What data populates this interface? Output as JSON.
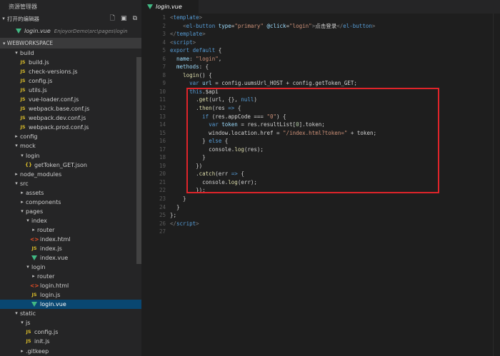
{
  "sidebar": {
    "title": "资源管理器",
    "open_editors_label": "打开的编辑器",
    "open_editor_file": {
      "name": "login.vue",
      "path": "EnjoyorDemo\\src\\pages\\login"
    },
    "workspace_label": "WEBWORKSPACE",
    "tree": [
      {
        "indent": 1,
        "twistie": "open",
        "icon": "",
        "label": "build"
      },
      {
        "indent": 2,
        "twistie": "none",
        "icon": "js",
        "label": "build.js"
      },
      {
        "indent": 2,
        "twistie": "none",
        "icon": "js",
        "label": "check-versions.js"
      },
      {
        "indent": 2,
        "twistie": "none",
        "icon": "js",
        "label": "config.js"
      },
      {
        "indent": 2,
        "twistie": "none",
        "icon": "js",
        "label": "utils.js"
      },
      {
        "indent": 2,
        "twistie": "none",
        "icon": "js",
        "label": "vue-loader.conf.js"
      },
      {
        "indent": 2,
        "twistie": "none",
        "icon": "js",
        "label": "webpack.base.conf.js"
      },
      {
        "indent": 2,
        "twistie": "none",
        "icon": "js",
        "label": "webpack.dev.conf.js"
      },
      {
        "indent": 2,
        "twistie": "none",
        "icon": "js",
        "label": "webpack.prod.conf.js"
      },
      {
        "indent": 1,
        "twistie": "closed",
        "icon": "",
        "label": "config"
      },
      {
        "indent": 1,
        "twistie": "open",
        "icon": "",
        "label": "mock"
      },
      {
        "indent": 2,
        "twistie": "open",
        "icon": "",
        "label": "login"
      },
      {
        "indent": 3,
        "twistie": "none",
        "icon": "json",
        "label": "getToken_GET.json"
      },
      {
        "indent": 1,
        "twistie": "closed",
        "icon": "",
        "label": "node_modules"
      },
      {
        "indent": 1,
        "twistie": "open",
        "icon": "",
        "label": "src"
      },
      {
        "indent": 2,
        "twistie": "closed",
        "icon": "",
        "label": "assets"
      },
      {
        "indent": 2,
        "twistie": "closed",
        "icon": "",
        "label": "components"
      },
      {
        "indent": 2,
        "twistie": "open",
        "icon": "",
        "label": "pages"
      },
      {
        "indent": 3,
        "twistie": "open",
        "icon": "",
        "label": "index"
      },
      {
        "indent": 4,
        "twistie": "closed",
        "icon": "",
        "label": "router"
      },
      {
        "indent": 4,
        "twistie": "none",
        "icon": "html",
        "label": "index.html"
      },
      {
        "indent": 4,
        "twistie": "none",
        "icon": "js",
        "label": "index.js"
      },
      {
        "indent": 4,
        "twistie": "none",
        "icon": "vue",
        "label": "index.vue"
      },
      {
        "indent": 3,
        "twistie": "open",
        "icon": "",
        "label": "login"
      },
      {
        "indent": 4,
        "twistie": "closed",
        "icon": "",
        "label": "router"
      },
      {
        "indent": 4,
        "twistie": "none",
        "icon": "html",
        "label": "login.html"
      },
      {
        "indent": 4,
        "twistie": "none",
        "icon": "js",
        "label": "login.js"
      },
      {
        "indent": 4,
        "twistie": "none",
        "icon": "vue",
        "label": "login.vue",
        "selected": true
      },
      {
        "indent": 1,
        "twistie": "open",
        "icon": "",
        "label": "static"
      },
      {
        "indent": 2,
        "twistie": "open",
        "icon": "",
        "label": "js"
      },
      {
        "indent": 3,
        "twistie": "none",
        "icon": "js",
        "label": "config.js"
      },
      {
        "indent": 3,
        "twistie": "none",
        "icon": "js",
        "label": "init.js"
      },
      {
        "indent": 2,
        "twistie": "closed",
        "icon": "",
        "label": ".gitkeep"
      }
    ]
  },
  "editor": {
    "tab_label": "login.vue",
    "lines": [
      [
        [
          "ang",
          "<"
        ],
        [
          "tag",
          "template"
        ],
        [
          "ang",
          ">"
        ]
      ],
      [
        [
          "plain",
          "    "
        ],
        [
          "ang",
          "<"
        ],
        [
          "tag",
          "el-button"
        ],
        [
          "plain",
          " "
        ],
        [
          "attr",
          "type"
        ],
        [
          "plain",
          "="
        ],
        [
          "str",
          "\"primary\""
        ],
        [
          "plain",
          " "
        ],
        [
          "attr",
          "@click"
        ],
        [
          "plain",
          "="
        ],
        [
          "str",
          "\"login\""
        ],
        [
          "ang",
          ">"
        ],
        [
          "plain",
          "点击登录"
        ],
        [
          "ang",
          "</"
        ],
        [
          "tag",
          "el-button"
        ],
        [
          "ang",
          ">"
        ]
      ],
      [
        [
          "ang",
          "</"
        ],
        [
          "tag",
          "template"
        ],
        [
          "ang",
          ">"
        ]
      ],
      [
        [
          "ang",
          "<"
        ],
        [
          "tag",
          "script"
        ],
        [
          "ang",
          ">"
        ]
      ],
      [
        [
          "kw",
          "export"
        ],
        [
          "plain",
          " "
        ],
        [
          "kw",
          "default"
        ],
        [
          "plain",
          " {"
        ]
      ],
      [
        [
          "plain",
          "  "
        ],
        [
          "prop",
          "name"
        ],
        [
          "plain",
          ": "
        ],
        [
          "str",
          "\"login\""
        ],
        [
          "plain",
          ","
        ]
      ],
      [
        [
          "plain",
          "  "
        ],
        [
          "prop",
          "methods"
        ],
        [
          "plain",
          ": {"
        ]
      ],
      [
        [
          "plain",
          "    "
        ],
        [
          "fn",
          "login"
        ],
        [
          "plain",
          "() {"
        ]
      ],
      [
        [
          "plain",
          "      "
        ],
        [
          "kw",
          "var"
        ],
        [
          "plain",
          " "
        ],
        [
          "prop",
          "url"
        ],
        [
          "plain",
          " = config.uumsUrl_HOST + config.getToken_GET;"
        ]
      ],
      [
        [
          "plain",
          "      "
        ],
        [
          "this",
          "this"
        ],
        [
          "plain",
          ".$api"
        ]
      ],
      [
        [
          "plain",
          "        ."
        ],
        [
          "fn",
          "get"
        ],
        [
          "plain",
          "(url, {}, "
        ],
        [
          "kw",
          "null"
        ],
        [
          "plain",
          ")"
        ]
      ],
      [
        [
          "plain",
          "        ."
        ],
        [
          "fn",
          "then"
        ],
        [
          "plain",
          "(res "
        ],
        [
          "kw",
          "=>"
        ],
        [
          "plain",
          " {"
        ]
      ],
      [
        [
          "plain",
          "          "
        ],
        [
          "kw",
          "if"
        ],
        [
          "plain",
          " (res.appCode === "
        ],
        [
          "str",
          "\"0\""
        ],
        [
          "plain",
          ") {"
        ]
      ],
      [
        [
          "plain",
          "            "
        ],
        [
          "kw",
          "var"
        ],
        [
          "plain",
          " "
        ],
        [
          "prop",
          "token"
        ],
        [
          "plain",
          " = res.resultList["
        ],
        [
          "num",
          "0"
        ],
        [
          "plain",
          "].token;"
        ]
      ],
      [
        [
          "plain",
          "            window.location.href = "
        ],
        [
          "str",
          "\"/index.html?token=\""
        ],
        [
          "plain",
          " + token;"
        ]
      ],
      [
        [
          "plain",
          "          } "
        ],
        [
          "kw",
          "else"
        ],
        [
          "plain",
          " {"
        ]
      ],
      [
        [
          "plain",
          "            console."
        ],
        [
          "fn",
          "log"
        ],
        [
          "plain",
          "(res);"
        ]
      ],
      [
        [
          "plain",
          "          }"
        ]
      ],
      [
        [
          "plain",
          "        })"
        ]
      ],
      [
        [
          "plain",
          "        ."
        ],
        [
          "fn",
          "catch"
        ],
        [
          "plain",
          "(err "
        ],
        [
          "kw",
          "=>"
        ],
        [
          "plain",
          " {"
        ]
      ],
      [
        [
          "plain",
          "          console."
        ],
        [
          "fn",
          "log"
        ],
        [
          "plain",
          "(err);"
        ]
      ],
      [
        [
          "plain",
          "        });"
        ]
      ],
      [
        [
          "plain",
          "    }"
        ]
      ],
      [
        [
          "plain",
          "  }"
        ]
      ],
      [
        [
          "plain",
          "};"
        ]
      ],
      [
        [
          "ang",
          "</"
        ],
        [
          "tag",
          "script"
        ],
        [
          "ang",
          ">"
        ]
      ],
      []
    ]
  },
  "colors": {
    "highlight_box": "#e0242a",
    "selection": "#094771",
    "vue_icon": "#41b883",
    "js_icon": "#d7ba2a",
    "html_icon": "#e44d26"
  }
}
